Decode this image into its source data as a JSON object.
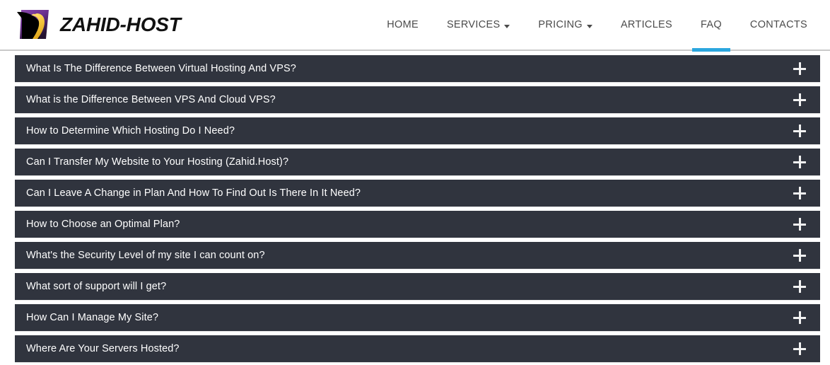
{
  "header": {
    "brand_name": "ZAHID-HOST",
    "logo_icon": "bird-logo-icon",
    "logo_colors": {
      "background_top": "#7b3f9d",
      "background_bottom": "#2a1538",
      "bird": "#000000",
      "beak": "#f5c242"
    },
    "nav": [
      {
        "label": "HOME",
        "has_caret": false,
        "active": false
      },
      {
        "label": "SERVICES",
        "has_caret": true,
        "active": false
      },
      {
        "label": "PRICING",
        "has_caret": true,
        "active": false
      },
      {
        "label": "ARTICLES",
        "has_caret": false,
        "active": false
      },
      {
        "label": "FAQ",
        "has_caret": false,
        "active": true
      },
      {
        "label": "CONTACTS",
        "has_caret": false,
        "active": false
      }
    ],
    "active_accent_color": "#2ba6de"
  },
  "faq": {
    "toggle_icon": "plus-icon",
    "row_color": "#30343e",
    "items": [
      {
        "question": "What Is The Difference Between Virtual Hosting And VPS?"
      },
      {
        "question": "What is the Difference Between VPS And Cloud VPS?"
      },
      {
        "question": "How to Determine Which Hosting Do I Need?"
      },
      {
        "question": "Can I Transfer My Website to Your Hosting (Zahid.Host)?"
      },
      {
        "question": "Can I Leave A Change in Plan And How To Find Out Is There In It Need?"
      },
      {
        "question": "How to Choose an Optimal Plan?"
      },
      {
        "question": "What's the Security Level of my site I can count on?"
      },
      {
        "question": "What sort of support will I get?"
      },
      {
        "question": "How Can I Manage My Site?"
      },
      {
        "question": "Where Are Your Servers Hosted?"
      }
    ]
  }
}
